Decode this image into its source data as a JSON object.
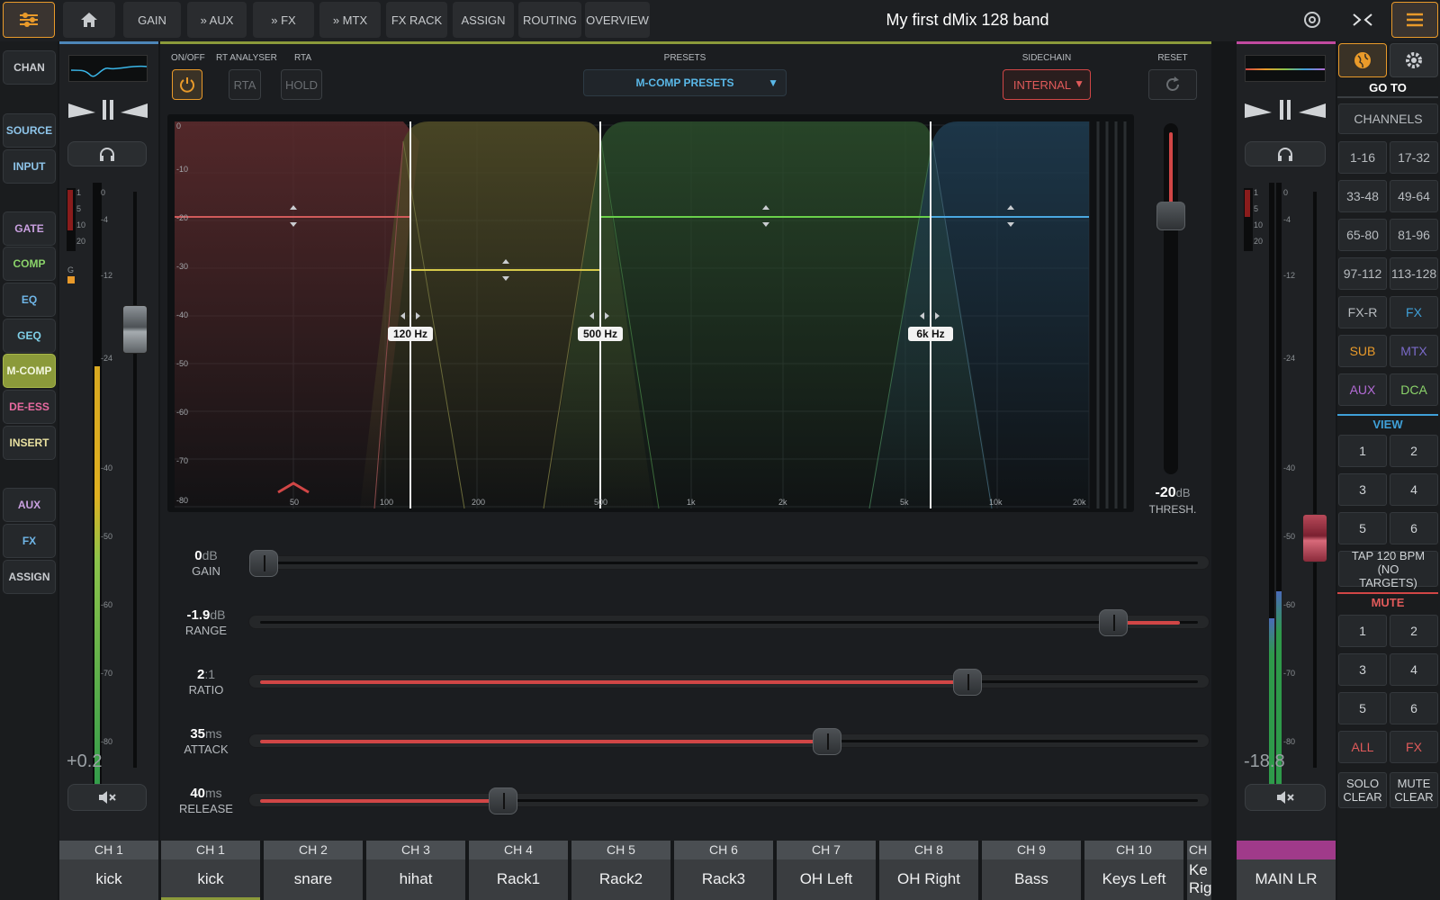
{
  "app_title": "My first dMix 128 band",
  "colors": {
    "accent_orange": "#e99a2a",
    "comp_green": "#8bc34a",
    "mcomp_bg": "#8b9a3a",
    "red": "#d14646",
    "blue": "#3fa0d8",
    "purple": "#b36bd6",
    "teal": "#29b39a"
  },
  "topnav": {
    "mixer_icon": "sliders-icon",
    "home_icon": "home-icon",
    "items": [
      "GAIN",
      "» AUX",
      "» FX",
      "» MTX",
      "FX RACK",
      "ASSIGN",
      "ROUTING",
      "OVERVIEW"
    ],
    "settings_icon": "gear-icon",
    "collapse_icon": "collapse-arrows-icon",
    "menu_icon": "menu-icon"
  },
  "leftnav": [
    "CHAN",
    "SOURCE",
    "INPUT",
    "GATE",
    "COMP",
    "EQ",
    "GEQ",
    "M-COMP",
    "DE-ESS",
    "INSERT",
    "AUX",
    "FX",
    "ASSIGN"
  ],
  "left_strip": {
    "level": "+0.2",
    "label_num": "CH 1",
    "label_name": "kick",
    "scale": [
      "0",
      "-4",
      "-12",
      "-24",
      "-40",
      "-50",
      "-60",
      "-70",
      "-80"
    ],
    "gr_scale": [
      "1",
      "5",
      "10",
      "20"
    ],
    "gr_label": "G"
  },
  "right_strip": {
    "level": "-18.8",
    "label": "MAIN LR",
    "scale": [
      "0",
      "-4",
      "-12",
      "-24",
      "-40",
      "-50",
      "-60",
      "-70",
      "-80"
    ],
    "gr_scale": [
      "1",
      "5",
      "10",
      "20"
    ]
  },
  "controls": {
    "onoff_label": "ON/OFF",
    "rta_analyser_label": "RT ANALYSER",
    "rta_label": "RTA",
    "rta_btn": "RTA",
    "hold_btn": "HOLD",
    "presets_label": "PRESETS",
    "presets_value": "M-COMP PRESETS",
    "sidechain_label": "SIDECHAIN",
    "sidechain_value": "INTERNAL",
    "reset_label": "RESET"
  },
  "graph": {
    "db_labels": [
      "0",
      "-10",
      "-20",
      "-30",
      "-40",
      "-50",
      "-60",
      "-70",
      "-80"
    ],
    "freq_labels": [
      "50",
      "100",
      "200",
      "500",
      "1k",
      "2k",
      "5k",
      "10k",
      "20k"
    ],
    "crossovers": [
      "120 Hz",
      "500 Hz",
      "6k Hz"
    ],
    "band_thresholds_db": [
      -20,
      -30,
      -20,
      -20
    ]
  },
  "threshold": {
    "value": "-20",
    "unit": "dB",
    "label": "THRESH."
  },
  "params": [
    {
      "value": "0",
      "unit": "dB",
      "name": "GAIN",
      "fraction": 0.0
    },
    {
      "value": "-1.9",
      "unit": "dB",
      "name": "RANGE",
      "fraction": 0.95
    },
    {
      "value": "2",
      "unit": ":1",
      "name": "RATIO",
      "fraction": 0.77
    },
    {
      "value": "35",
      "unit": "ms",
      "name": "ATTACK",
      "fraction": 0.62
    },
    {
      "value": "40",
      "unit": "ms",
      "name": "RELEASE",
      "fraction": 0.27
    }
  ],
  "channels": [
    {
      "num": "CH 1",
      "name": "kick"
    },
    {
      "num": "CH 2",
      "name": "snare"
    },
    {
      "num": "CH 3",
      "name": "hihat"
    },
    {
      "num": "CH 4",
      "name": "Rack1"
    },
    {
      "num": "CH 5",
      "name": "Rack2"
    },
    {
      "num": "CH 6",
      "name": "Rack3"
    },
    {
      "num": "CH 7",
      "name": "OH Left"
    },
    {
      "num": "CH 8",
      "name": "OH Right"
    },
    {
      "num": "CH 9",
      "name": "Bass"
    },
    {
      "num": "CH 10",
      "name": "Keys Left"
    },
    {
      "num": "CH",
      "name": "Ke\nRig"
    }
  ],
  "rightpanel": {
    "goto": "GO TO",
    "channels": "CHANNELS",
    "ranges": [
      "1-16",
      "17-32",
      "33-48",
      "49-64",
      "65-80",
      "81-96",
      "97-112",
      "113-128"
    ],
    "types": [
      "FX-R",
      "FX",
      "SUB",
      "MTX",
      "AUX",
      "DCA"
    ],
    "view": "VIEW",
    "view_btns": [
      "1",
      "2",
      "3",
      "4",
      "5",
      "6"
    ],
    "tap": "TAP 120 BPM (NO TARGETS)",
    "mute": "MUTE",
    "mute_btns": [
      "1",
      "2",
      "3",
      "4",
      "5",
      "6"
    ],
    "all": "ALL",
    "fx": "FX",
    "solo_clear": "SOLO CLEAR",
    "mute_clear": "MUTE CLEAR"
  }
}
